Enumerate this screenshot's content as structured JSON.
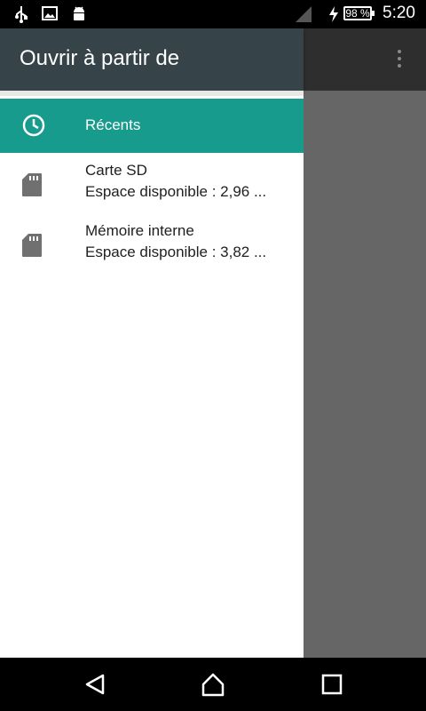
{
  "status_bar": {
    "time": "5:20",
    "battery": "98 %",
    "icons": [
      "usb-icon",
      "image-icon",
      "android-icon",
      "signal-icon",
      "charging-icon"
    ]
  },
  "drawer": {
    "title": "Ouvrir à partir de",
    "items": [
      {
        "label": "Récents",
        "icon": "clock-icon",
        "selected": true
      },
      {
        "title": "Carte SD",
        "subtitle": "Espace disponible : 2,96 ...",
        "icon": "sd-card-icon"
      },
      {
        "title": "Mémoire interne",
        "subtitle": "Espace disponible : 3,82 ...",
        "icon": "sd-card-icon"
      }
    ]
  },
  "colors": {
    "header": "#36444a",
    "selected": "#169b8c",
    "overlay": "#666666"
  },
  "nav_bar": {
    "buttons": [
      "back-icon",
      "home-icon",
      "recents-icon"
    ]
  }
}
